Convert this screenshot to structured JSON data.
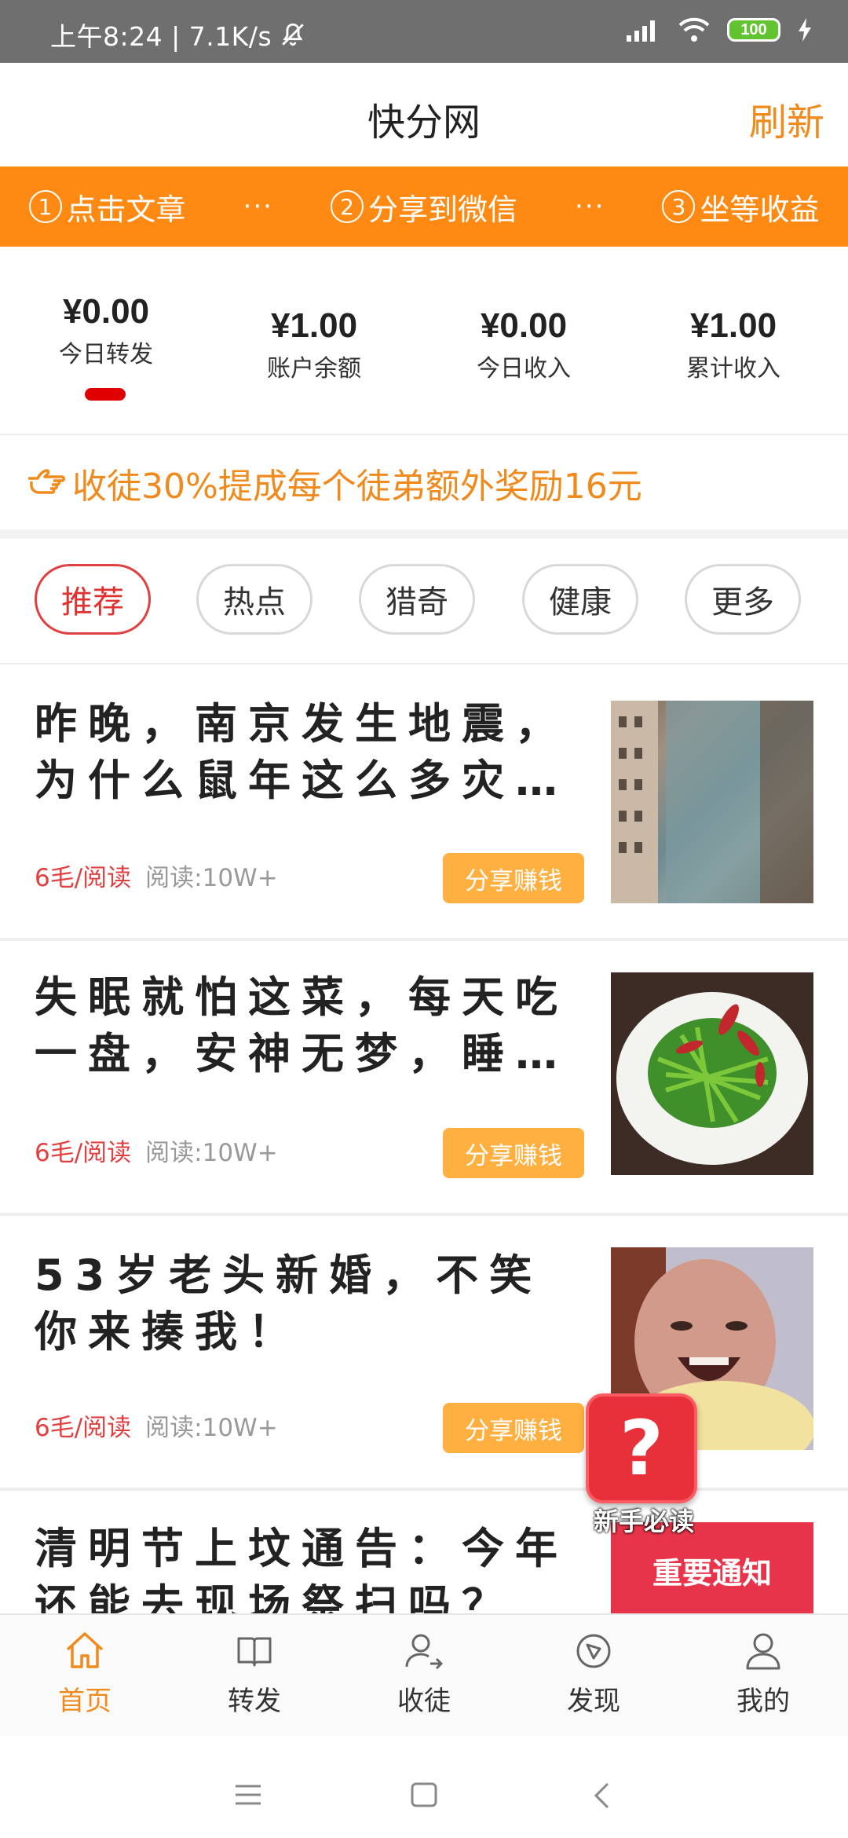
{
  "status_bar": {
    "time": "上午8:24 | 7.1K/s",
    "battery": "100"
  },
  "header": {
    "title": "快分网",
    "refresh_label": "刷新"
  },
  "steps": [
    {
      "num": "1",
      "label": "点击文章"
    },
    {
      "num": "2",
      "label": "分享到微信"
    },
    {
      "num": "3",
      "label": "坐等收益"
    }
  ],
  "steps_separator": "···",
  "stats": [
    {
      "value": "¥0.00",
      "label": "今日转发"
    },
    {
      "value": "¥1.00",
      "label": "账户余额"
    },
    {
      "value": "¥0.00",
      "label": "今日收入"
    },
    {
      "value": "¥1.00",
      "label": "累计收入"
    }
  ],
  "promo": {
    "text": "收徒30%提成每个徒弟额外奖励16元"
  },
  "tabs": [
    "推荐",
    "热点",
    "猎奇",
    "健康",
    "更多"
  ],
  "articles": [
    {
      "title": "昨晚，南京发生地震，为什么鼠年这么多灾…",
      "rate": "6毛/阅读",
      "reads": "阅读:10W+",
      "share": "分享赚钱"
    },
    {
      "title": "失眠就怕这菜，每天吃一盘，安神无梦，睡…",
      "rate": "6毛/阅读",
      "reads": "阅读:10W+",
      "share": "分享赚钱"
    },
    {
      "title": "53岁老头新婚，不笑你来揍我！",
      "rate": "6毛/阅读",
      "reads": "阅读:10W+",
      "share": "分享赚钱"
    },
    {
      "title": "清明节上坟通告：今年还能去现场祭扫吗？",
      "thumb_text": "重要通知"
    }
  ],
  "help_float": {
    "symbol": "?",
    "label": "新手必读"
  },
  "bottom_nav": [
    {
      "label": "首页",
      "icon": "home-icon",
      "active": true
    },
    {
      "label": "转发",
      "icon": "book-icon"
    },
    {
      "label": "收徒",
      "icon": "add-user-icon"
    },
    {
      "label": "发现",
      "icon": "compass-icon"
    },
    {
      "label": "我的",
      "icon": "profile-icon"
    }
  ],
  "colors": {
    "accent": "#ff8a13",
    "red": "#e04040",
    "share_button": "#ffb040"
  }
}
